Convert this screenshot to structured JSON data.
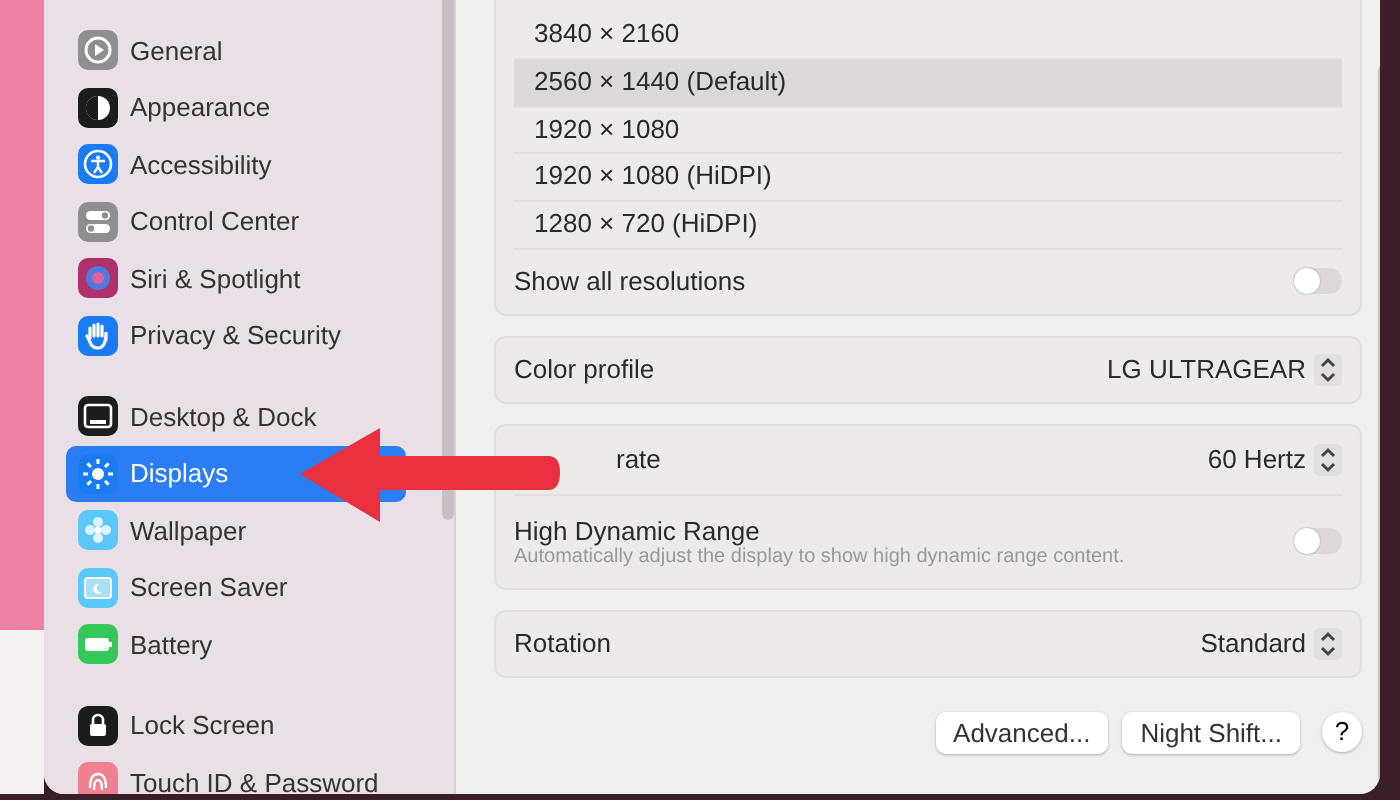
{
  "sidebar": {
    "groups": [
      {
        "items": [
          {
            "label": "General",
            "selected": false,
            "color": "#8e8e93"
          },
          {
            "label": "Appearance",
            "selected": false,
            "color": "#1c1c1e"
          },
          {
            "label": "Accessibility",
            "selected": false,
            "color": "#1a7cf5"
          },
          {
            "label": "Control Center",
            "selected": false,
            "color": "#8e8e93"
          },
          {
            "label": "Siri & Spotlight",
            "selected": false,
            "color": "#b0306a"
          },
          {
            "label": "Privacy & Security",
            "selected": false,
            "color": "#1a7cf5"
          }
        ]
      },
      {
        "items": [
          {
            "label": "Desktop & Dock",
            "selected": false,
            "color": "#1c1c1e"
          },
          {
            "label": "Displays",
            "selected": true,
            "color": "#1a7cf5"
          },
          {
            "label": "Wallpaper",
            "selected": false,
            "color": "#5ac8fa"
          },
          {
            "label": "Screen Saver",
            "selected": false,
            "color": "#5ac8fa"
          },
          {
            "label": "Battery",
            "selected": false,
            "color": "#34c759"
          }
        ]
      },
      {
        "items": [
          {
            "label": "Lock Screen",
            "selected": false,
            "color": "#1c1c1e"
          },
          {
            "label": "Touch ID & Password",
            "selected": false,
            "color": "#f08090"
          }
        ]
      }
    ]
  },
  "resolutions": [
    {
      "label": "3840 × 2160",
      "selected": false
    },
    {
      "label": "2560 × 1440 (Default)",
      "selected": true
    },
    {
      "label": "1920 × 1080",
      "selected": false
    },
    {
      "label": "1920 × 1080 (HiDPI)",
      "selected": false
    },
    {
      "label": "1280 × 720 (HiDPI)",
      "selected": false
    }
  ],
  "show_all": {
    "label": "Show all resolutions",
    "on": false
  },
  "color_profile": {
    "label": "Color profile",
    "value": "LG ULTRAGEAR"
  },
  "refresh_rate": {
    "label": "rate",
    "value": "60 Hertz"
  },
  "hdr": {
    "label": "High Dynamic Range",
    "description": "Automatically adjust the display to show high dynamic range content.",
    "on": false
  },
  "rotation": {
    "label": "Rotation",
    "value": "Standard"
  },
  "buttons": [
    "Advanced...",
    "Night Shift..."
  ],
  "help": "?"
}
